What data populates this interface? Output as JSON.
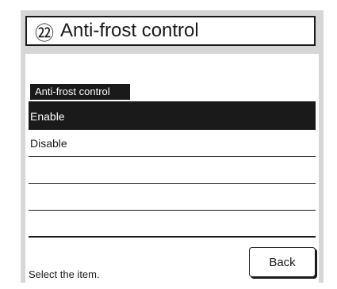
{
  "header": {
    "step_number": "㉒",
    "title": "Anti-frost control"
  },
  "section": {
    "label": "Anti-frost control"
  },
  "options": [
    {
      "label": "Enable",
      "selected": true
    },
    {
      "label": "Disable",
      "selected": false
    },
    {
      "label": "",
      "selected": false
    },
    {
      "label": "",
      "selected": false
    },
    {
      "label": "",
      "selected": false
    }
  ],
  "status": {
    "text": "Select the item."
  },
  "buttons": {
    "back_label": "Back"
  }
}
